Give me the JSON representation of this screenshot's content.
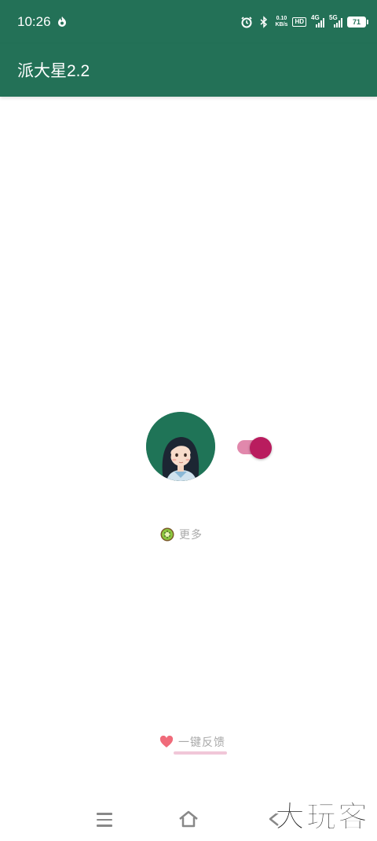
{
  "status_bar": {
    "time": "10:26",
    "net_speed_value": "0.10",
    "net_speed_unit": "KB/s",
    "hd_badge": "HD",
    "sim1_label": "4G",
    "sim2_label": "5G",
    "battery": "71"
  },
  "app_bar": {
    "title": "派大星2.2"
  },
  "main": {
    "toggle_on": true,
    "more_label": "更多",
    "feedback_label": "一键反馈"
  },
  "watermark": {
    "text": "大玩客"
  },
  "colors": {
    "primary": "#237157",
    "toggle_thumb": "#b91c5e",
    "toggle_track": "#e188ac",
    "muted_text": "#a9a9a9",
    "heart": "#f06b7a"
  }
}
